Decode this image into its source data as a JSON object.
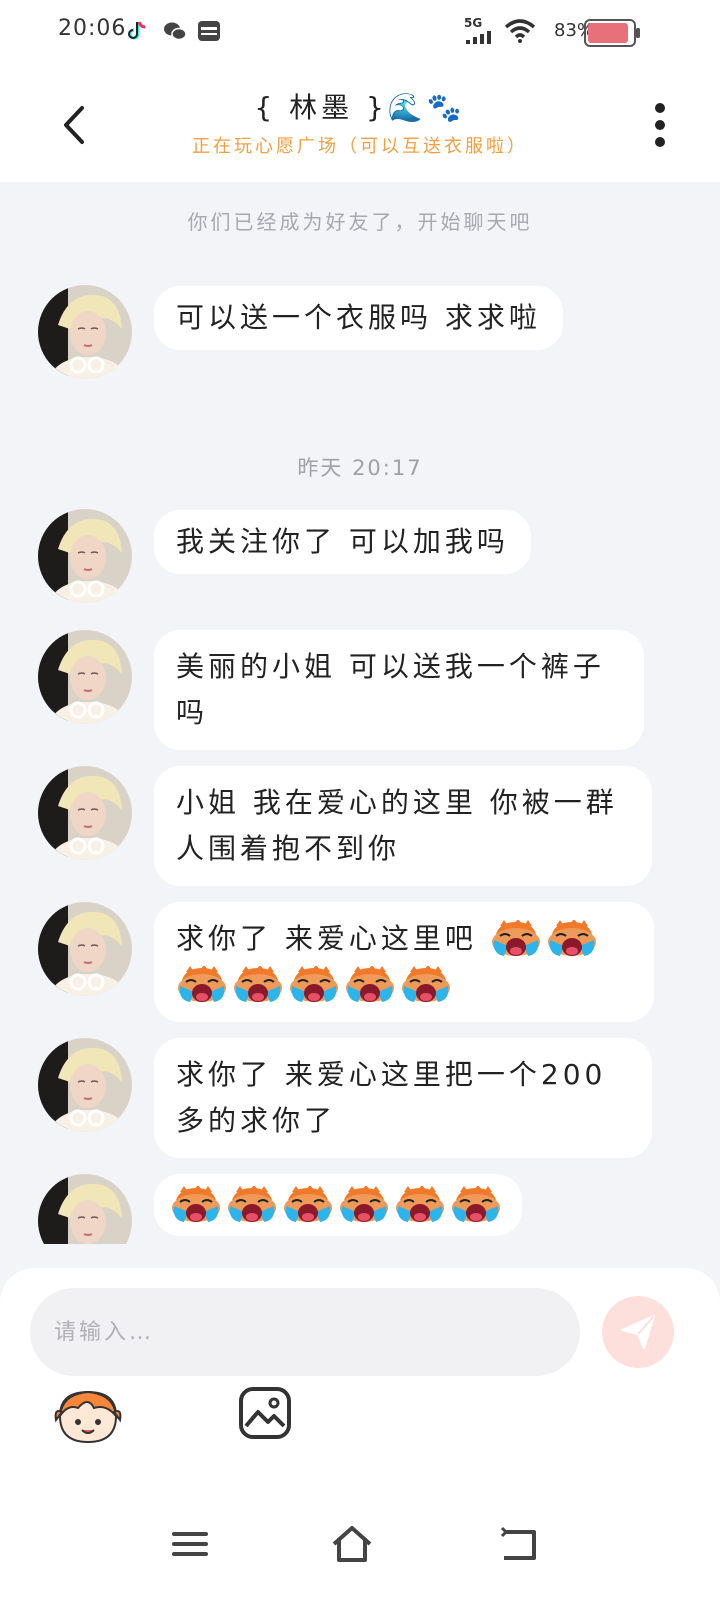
{
  "status_bar": {
    "time": "20:06",
    "network": "5G",
    "battery": "83%",
    "left_icons": [
      "tiktok-icon",
      "wechat-icon",
      "wallet-icon"
    ],
    "battery_color": "#e8707a"
  },
  "header": {
    "title": "{ 林墨 }🌊🐾",
    "subtitle": "正在玩心愿广场（可以互送衣服啦）",
    "subtitle_color": "#f0a040"
  },
  "chat": {
    "system_notice": "你们已经成为好友了，开始聊天吧",
    "timestamp": "昨天 20:17",
    "messages": [
      {
        "text": "可以送一个衣服吗 求求啦"
      },
      {
        "text": "我关注你了 可以加我吗"
      },
      {
        "text": "美丽的小姐 可以送我一个裤子吗"
      },
      {
        "text": "小姐 我在爱心的这里 你被一群人围着抱不到你"
      },
      {
        "text": "求你了 来爱心这里吧",
        "emoji": "crying-face-emoji",
        "emoji_count": 7
      },
      {
        "text": "求你了 来爱心这里把一个200多的求你了"
      },
      {
        "text": "",
        "emoji": "crying-face-emoji",
        "emoji_count": 6
      }
    ]
  },
  "input": {
    "placeholder": "请输入…",
    "accent_color": "#f28b7d"
  }
}
